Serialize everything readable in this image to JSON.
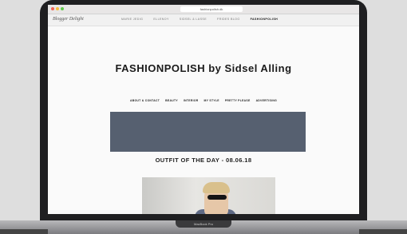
{
  "browser": {
    "url": "fashionpolish.dk"
  },
  "topnav": {
    "brand": "Blogger Delight",
    "links": [
      "MARIE JEDIG",
      "ELLENOY",
      "SIDSEL & LASSE",
      "FRIDES BLOG",
      "FASHIONPOLISH"
    ],
    "active_index": 4
  },
  "site": {
    "title": "FASHIONPOLISH  by Sidsel Alling",
    "nav": [
      "ABOUT & CONTACT",
      "BEAUTY",
      "INTERIOR",
      "MY STYLE",
      "PRETTY PLEASE",
      "ADVERTISING"
    ]
  },
  "post": {
    "title": "OUTFIT OF THE DAY - 08.06.18"
  },
  "device": {
    "model_label": "MacBook Pro"
  },
  "colors": {
    "banner": "#566070",
    "bezel": "#1f1f21"
  }
}
